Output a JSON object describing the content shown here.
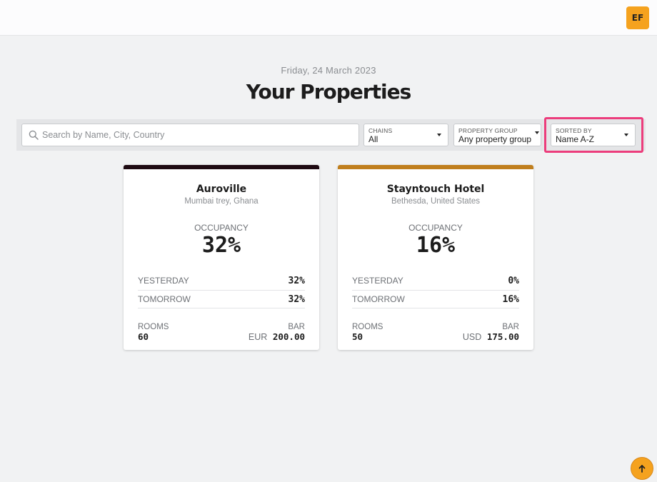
{
  "header": {
    "avatar_initials": "EF"
  },
  "page": {
    "date": "Friday, 24 March 2023",
    "title": "Your Properties"
  },
  "filters": {
    "search_placeholder": "Search by Name, City, Country",
    "chains": {
      "label": "CHAINS",
      "value": "All"
    },
    "property_group": {
      "label": "PROPERTY GROUP",
      "value": "Any property group"
    },
    "sorted_by": {
      "label": "SORTED BY",
      "value": "Name A-Z"
    }
  },
  "properties": [
    {
      "name": "Auroville",
      "location": "Mumbai trey, Ghana",
      "accent_color": "#1e0a12",
      "occupancy_label": "OCCUPANCY",
      "occupancy": "32%",
      "yesterday_label": "YESTERDAY",
      "yesterday": "32%",
      "tomorrow_label": "TOMORROW",
      "tomorrow": "32%",
      "rooms_label": "ROOMS",
      "rooms": "60",
      "bar_label": "BAR",
      "bar_currency": "EUR",
      "bar_value": "200.00"
    },
    {
      "name": "Stayntouch Hotel",
      "location": "Bethesda, United States",
      "accent_color": "#c07f1e",
      "occupancy_label": "OCCUPANCY",
      "occupancy": "16%",
      "yesterday_label": "YESTERDAY",
      "yesterday": "0%",
      "tomorrow_label": "TOMORROW",
      "tomorrow": "16%",
      "rooms_label": "ROOMS",
      "rooms": "50",
      "bar_label": "BAR",
      "bar_currency": "USD",
      "bar_value": "175.00"
    }
  ],
  "colors": {
    "accent": "#f5a21e",
    "highlight": "#ec3d7c",
    "background": "#f1f2f3"
  },
  "icons": {
    "search": "search-icon",
    "scroll_top": "arrow-up-icon"
  }
}
